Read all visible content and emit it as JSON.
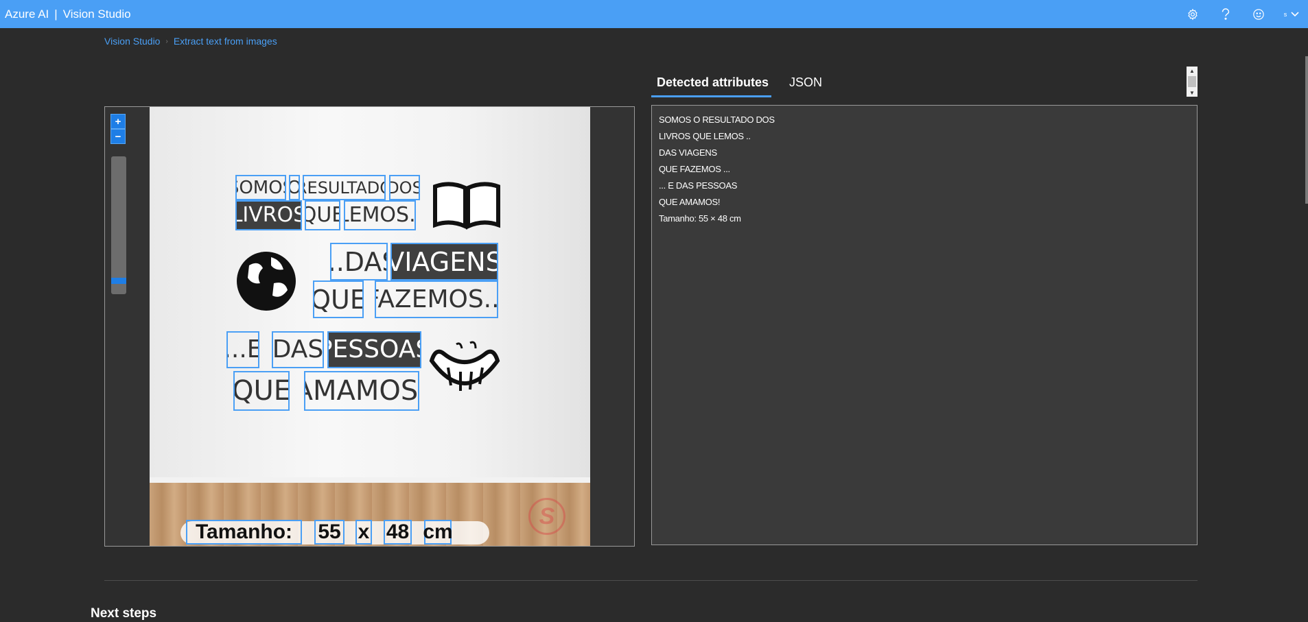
{
  "header": {
    "brand_left": "Azure AI",
    "brand_sep": "|",
    "brand_right": "Vision Studio",
    "icons": [
      "settings-icon",
      "help-icon",
      "feedback-smiley-icon"
    ],
    "avatar_letter": "s",
    "colors": {
      "bar": "#4a9ff5"
    }
  },
  "breadcrumb": {
    "items": [
      "Vision Studio",
      "Extract text from images"
    ],
    "separator": "›"
  },
  "viewer": {
    "zoom_in": "+",
    "zoom_out": "−",
    "zoom_level": 0.05,
    "ocr_words": [
      "SOMOS",
      "O",
      "RESULTADO",
      "DOS",
      "LIVROS",
      "QUE",
      "LEMOS..",
      "...DAS",
      "VIAGENS",
      "QUE",
      "FAZEMOS...",
      "...E",
      "DAS",
      "PESSOAS",
      "QUE",
      "AMAMOS!"
    ],
    "size_words": [
      "Tamanho:",
      "55",
      "x",
      "48",
      "cm"
    ],
    "watermark": "S"
  },
  "panel": {
    "tabs": [
      {
        "label": "Detected attributes",
        "active": true
      },
      {
        "label": "JSON",
        "active": false
      }
    ],
    "lines": [
      "SOMOS O RESULTADO DOS",
      "LIVROS QUE LEMOS ..",
      "DAS VIAGENS",
      "QUE FAZEMOS ...",
      "... E DAS PESSOAS",
      "QUE AMAMOS!",
      "Tamanho: 55 × 48 cm"
    ]
  },
  "footer": {
    "next_steps": "Next steps"
  }
}
